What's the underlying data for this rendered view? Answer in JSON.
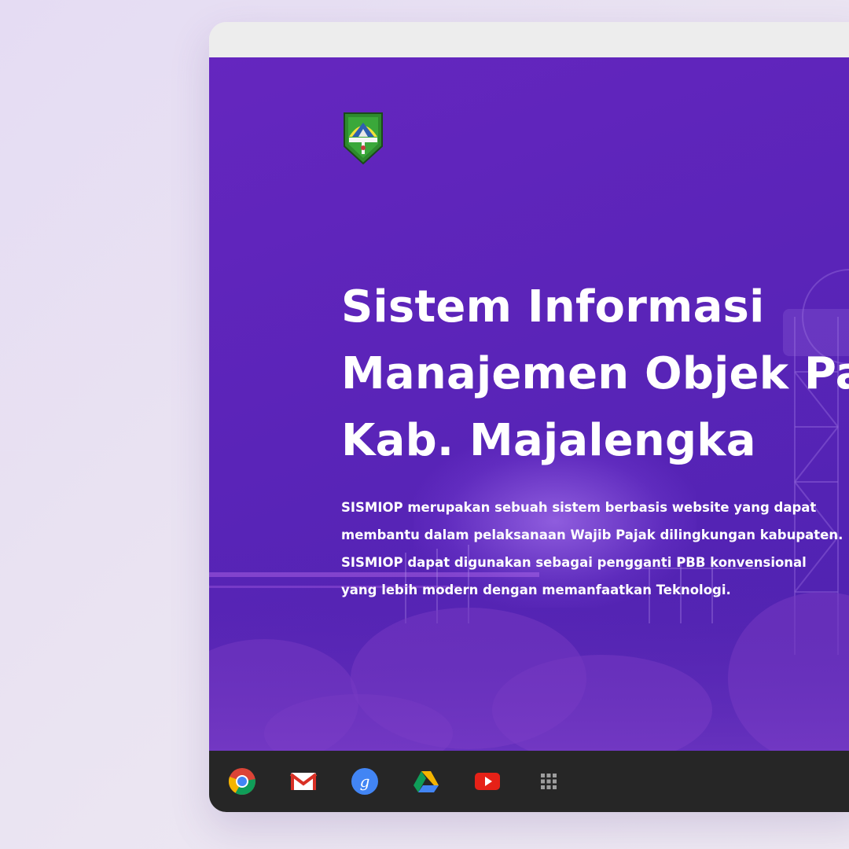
{
  "hero": {
    "title_lines": [
      "Sistem Informasi",
      "Manajemen Objek Pajak",
      "Kab. Majalengka"
    ],
    "description_lines": [
      "SISMIOP merupakan sebuah sistem berbasis website yang dapat",
      "membantu dalam pelaksanaan Wajib Pajak dilingkungan kabupaten.",
      "SISMIOP dapat digunakan sebagai pengganti PBB konvensional",
      "yang lebih modern dengan memanfaatkan Teknologi."
    ]
  },
  "logo": {
    "icon": "majalengka-regency-emblem"
  },
  "shelf": {
    "apps": [
      {
        "icon": "chrome-icon"
      },
      {
        "icon": "gmail-icon"
      },
      {
        "icon": "google-search-icon",
        "glyph": "g"
      },
      {
        "icon": "drive-icon"
      },
      {
        "icon": "youtube-icon"
      },
      {
        "icon": "app-launcher-icon"
      }
    ]
  },
  "colors": {
    "hero_bg": "#5a24b8",
    "shelf_bg": "#262626",
    "text": "#ffffff"
  }
}
